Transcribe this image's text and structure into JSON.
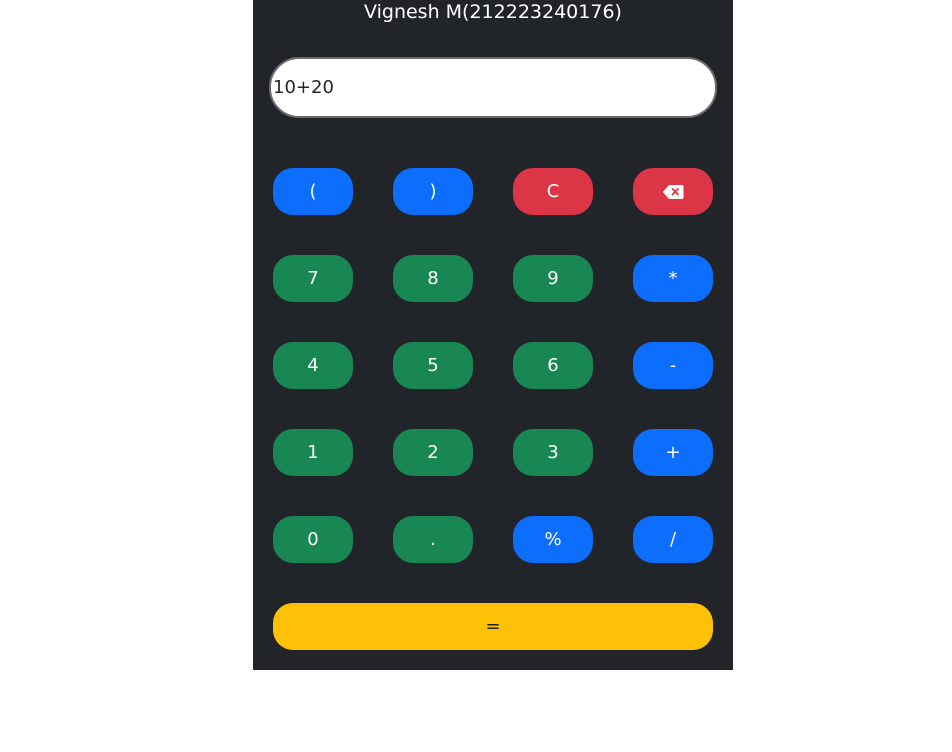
{
  "title": "Vignesh M(212223240176)",
  "display": {
    "value": "10+20"
  },
  "buttons": {
    "open_paren": "(",
    "close_paren": ")",
    "clear": "C",
    "backspace_icon": "backspace-icon",
    "seven": "7",
    "eight": "8",
    "nine": "9",
    "multiply": "*",
    "four": "4",
    "five": "5",
    "six": "6",
    "minus": "-",
    "one": "1",
    "two": "2",
    "three": "3",
    "plus": "+",
    "zero": "0",
    "dot": ".",
    "percent": "%",
    "divide": "/",
    "equals": "="
  },
  "colors": {
    "background": "#212529",
    "operator": "#0d6efd",
    "digit": "#198754",
    "danger": "#dc3545",
    "equals": "#ffc107"
  }
}
